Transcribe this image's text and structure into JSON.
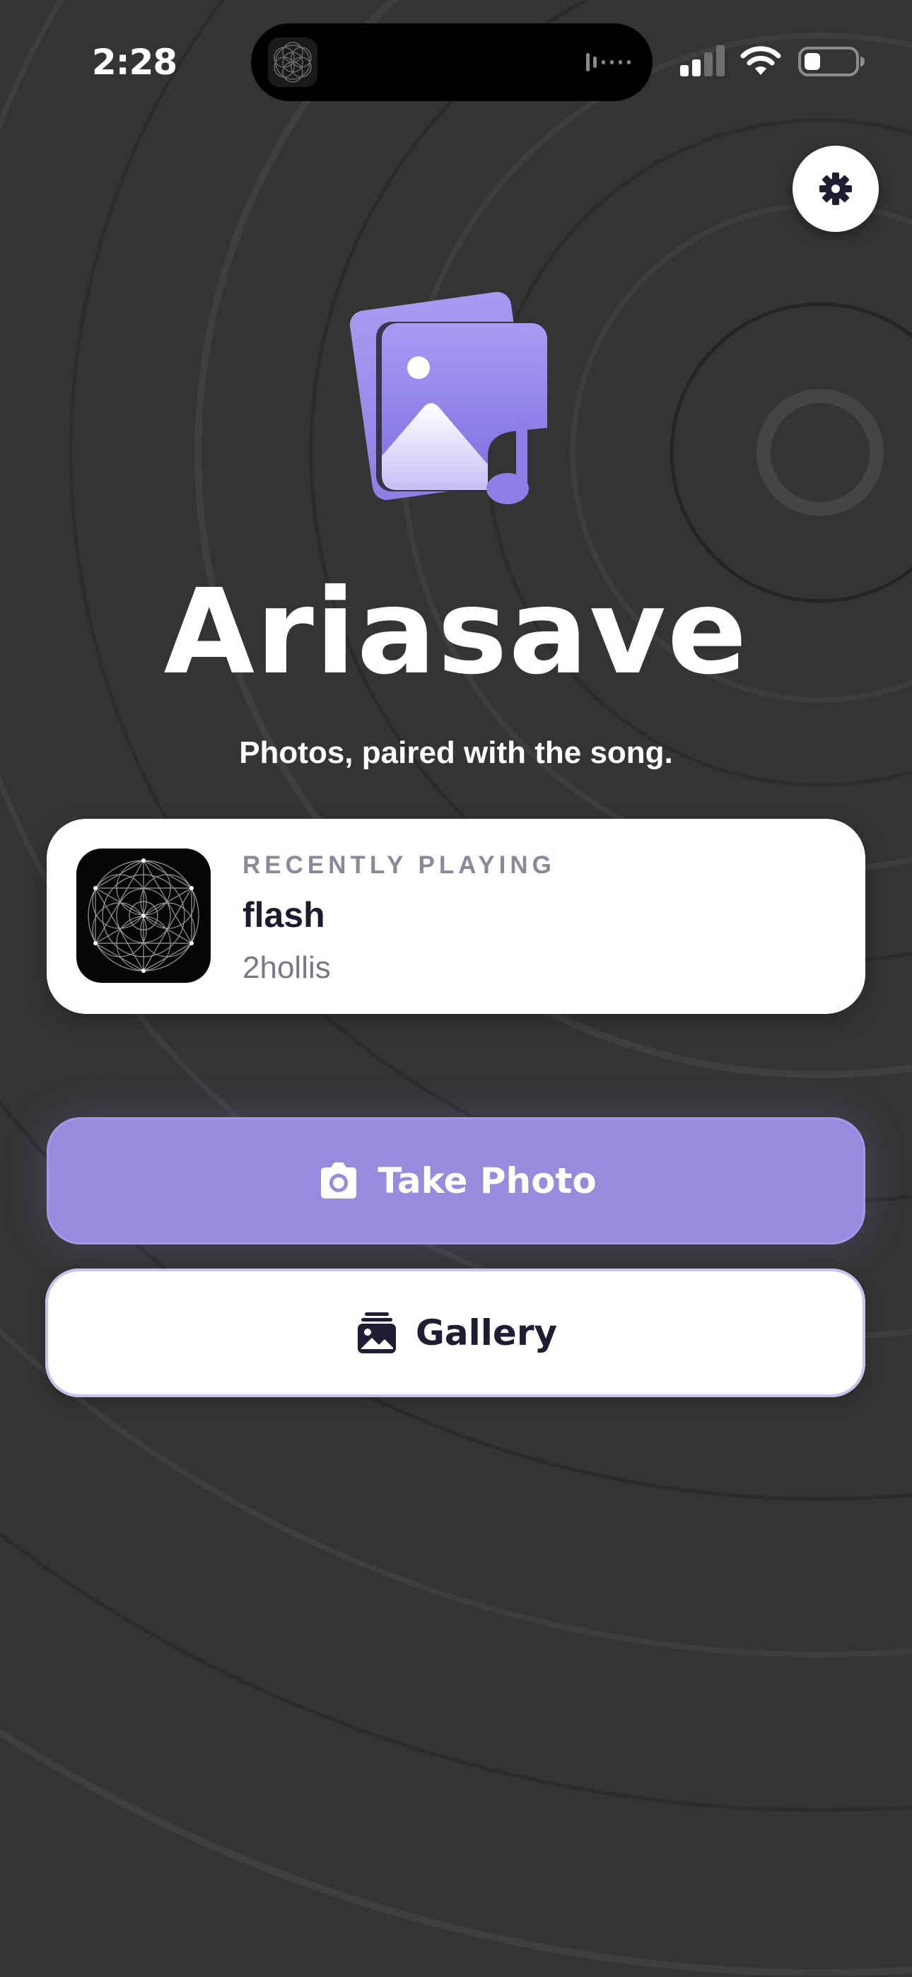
{
  "status_bar": {
    "time": "2:28"
  },
  "app": {
    "title": "Ariasave",
    "subtitle": "Photos, paired with the song."
  },
  "now_playing": {
    "eyebrow": "RECENTLY PLAYING",
    "song": "flash",
    "artist": "2hollis"
  },
  "actions": {
    "take_photo_label": "Take Photo",
    "gallery_label": "Gallery"
  },
  "colors": {
    "background": "#343435",
    "accent": "#9a8ade",
    "accent_light": "#c9c1ef",
    "card": "#ffffff",
    "text_dark": "#1d1b2e",
    "text_muted": "#8a8899"
  },
  "icons": {
    "settings": "gear-icon",
    "take_photo": "camera-icon",
    "gallery": "gallery-icon",
    "logo": "photo-music-logo",
    "signal": "cellular-signal-icon",
    "wifi": "wifi-icon",
    "battery": "battery-icon"
  }
}
